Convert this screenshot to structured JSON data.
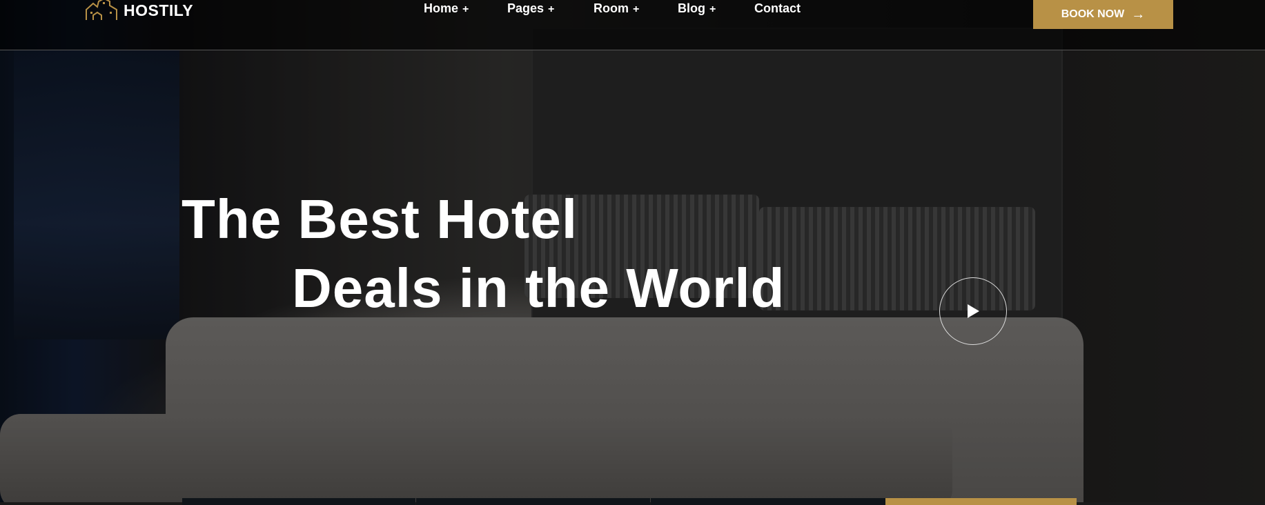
{
  "brand": {
    "name": "HOSTILY",
    "accent": "#b89146"
  },
  "nav": {
    "items": [
      {
        "label": "Home",
        "plus": "+"
      },
      {
        "label": "Pages",
        "plus": "+"
      },
      {
        "label": "Room",
        "plus": "+"
      },
      {
        "label": "Blog",
        "plus": "+"
      },
      {
        "label": "Contact"
      }
    ],
    "book_now": "BOOK NOW",
    "book_icon": "→"
  },
  "hero": {
    "line1": "The Best Hotel",
    "line2": "Deals in the World",
    "play_icon": "play-icon"
  }
}
